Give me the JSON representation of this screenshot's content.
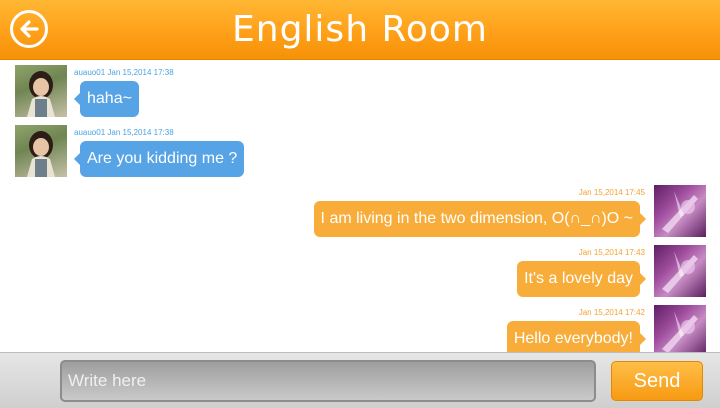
{
  "header": {
    "title": "English Room",
    "back_icon": "back-arrow-icon"
  },
  "messages": [
    {
      "side": "left",
      "avatar": "girl-avatar",
      "meta": "auauo01 Jan 15,2014 17:38",
      "text": "haha~"
    },
    {
      "side": "left",
      "avatar": "girl-avatar",
      "meta": "auauo01 Jan 15,2014 17:38",
      "text": "Are you kidding me ?"
    },
    {
      "side": "right",
      "avatar": "purple-avatar",
      "meta": "Jan 15,2014 17:45",
      "text": "I am living in the two dimension, O(∩_∩)O ~"
    },
    {
      "side": "right",
      "avatar": "purple-avatar",
      "meta": "Jan 15,2014 17:43",
      "text": "It's a lovely day"
    },
    {
      "side": "right",
      "avatar": "purple-avatar",
      "meta": "Jan 15,2014 17:42",
      "text": "Hello everybody!"
    }
  ],
  "composer": {
    "placeholder": "Write here",
    "send_label": "Send"
  },
  "colors": {
    "header_orange": "#ffa01a",
    "bubble_blue": "#56a3e6",
    "bubble_orange": "#f8ad3b"
  }
}
